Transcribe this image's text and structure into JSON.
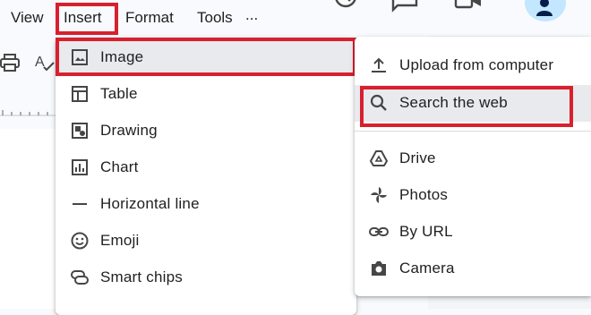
{
  "menubar": {
    "items": [
      {
        "label": "View"
      },
      {
        "label": "Insert"
      },
      {
        "label": "Format"
      },
      {
        "label": "Tools"
      },
      {
        "label": "..."
      }
    ]
  },
  "toolbar": {
    "icons": [
      "printer-icon",
      "spellcheck-icon"
    ],
    "top_icons": [
      "history-icon",
      "comment-icon",
      "video-icon",
      "share-avatar-icon"
    ]
  },
  "insert_menu": {
    "items": [
      {
        "label": "Image",
        "icon": "image-icon",
        "selected": true
      },
      {
        "label": "Table",
        "icon": "table-icon"
      },
      {
        "label": "Drawing",
        "icon": "drawing-icon"
      },
      {
        "label": "Chart",
        "icon": "chart-icon"
      },
      {
        "label": "Horizontal line",
        "icon": "horizontal-line-icon"
      },
      {
        "label": "Emoji",
        "icon": "emoji-icon"
      },
      {
        "label": "Smart chips",
        "icon": "smart-chips-icon"
      }
    ]
  },
  "image_submenu": {
    "items": [
      {
        "label": "Upload from computer",
        "icon": "upload-icon"
      },
      {
        "label": "Search the web",
        "icon": "search-icon",
        "selected": true
      },
      {
        "label": "Drive",
        "icon": "drive-icon"
      },
      {
        "label": "Photos",
        "icon": "photos-icon"
      },
      {
        "label": "By URL",
        "icon": "link-icon"
      },
      {
        "label": "Camera",
        "icon": "camera-icon"
      }
    ]
  },
  "colors": {
    "highlight": "#d8202f",
    "accent": "#c2e7ff",
    "selected_row": "#e8eaed"
  }
}
